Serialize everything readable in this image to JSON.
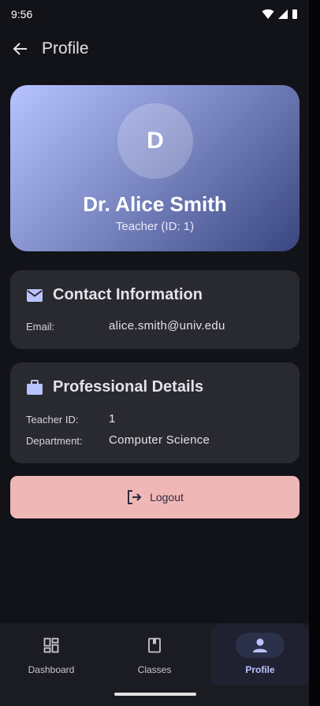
{
  "status_bar": {
    "time": "9:56"
  },
  "app_bar": {
    "title": "Profile"
  },
  "profile": {
    "initial": "D",
    "name": "Dr. Alice Smith",
    "subtitle": "Teacher (ID: 1)"
  },
  "contact": {
    "title": "Contact Information",
    "email_label": "Email:",
    "email_value": "alice.smith@univ.edu"
  },
  "professional": {
    "title": "Professional Details",
    "teacher_id_label": "Teacher ID:",
    "teacher_id_value": "1",
    "department_label": "Department:",
    "department_value": "Computer Science"
  },
  "logout": {
    "label": "Logout"
  },
  "bottom_nav": {
    "items": [
      {
        "label": "Dashboard",
        "icon": "dashboard-icon"
      },
      {
        "label": "Classes",
        "icon": "book-icon"
      },
      {
        "label": "Profile",
        "icon": "person-icon",
        "active": true
      }
    ]
  },
  "colors": {
    "accent": "#b9c3ff",
    "logout_bg": "#f0b7b7",
    "card_bg": "#292a30",
    "page_bg": "#121318"
  }
}
